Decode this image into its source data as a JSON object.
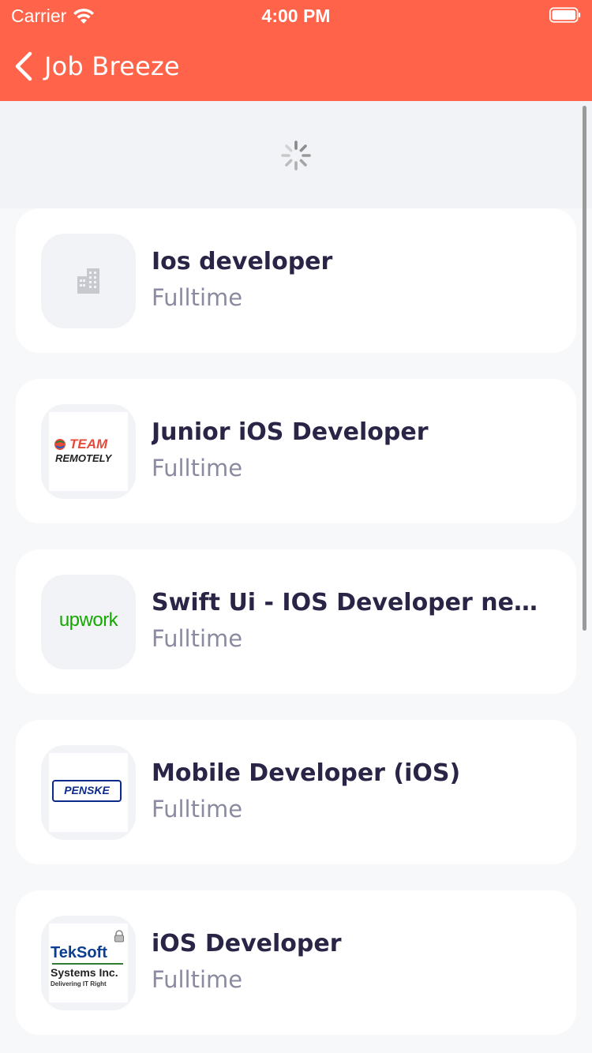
{
  "status_bar": {
    "carrier": "Carrier",
    "time": "4:00 PM"
  },
  "nav": {
    "back_title": "Job Breeze"
  },
  "jobs": [
    {
      "title": "Ios developer",
      "type": "Fulltime",
      "logo": "building-placeholder-icon"
    },
    {
      "title": "Junior iOS Developer",
      "type": "Fulltime",
      "logo": "team-remotely-logo",
      "logo_text_1": "TEAM",
      "logo_text_2": "REMOTELY"
    },
    {
      "title": "Swift Ui - IOS Developer needed",
      "type": "Fulltime",
      "logo": "upwork-logo",
      "logo_text": "upwork"
    },
    {
      "title": "Mobile Developer (iOS)",
      "type": "Fulltime",
      "logo": "penske-logo",
      "logo_text": "PENSKE"
    },
    {
      "title": "iOS Developer",
      "type": "Fulltime",
      "logo": "teksoft-logo",
      "logo_text_1": "TekSoft",
      "logo_text_2": "Systems Inc.",
      "logo_text_3": "Delivering IT Right"
    }
  ],
  "colors": {
    "header": "#ff6349",
    "title": "#2a2547",
    "subtitle": "#8a8aa0",
    "upwork_green": "#14a800",
    "penske_blue": "#0b2a8a"
  }
}
